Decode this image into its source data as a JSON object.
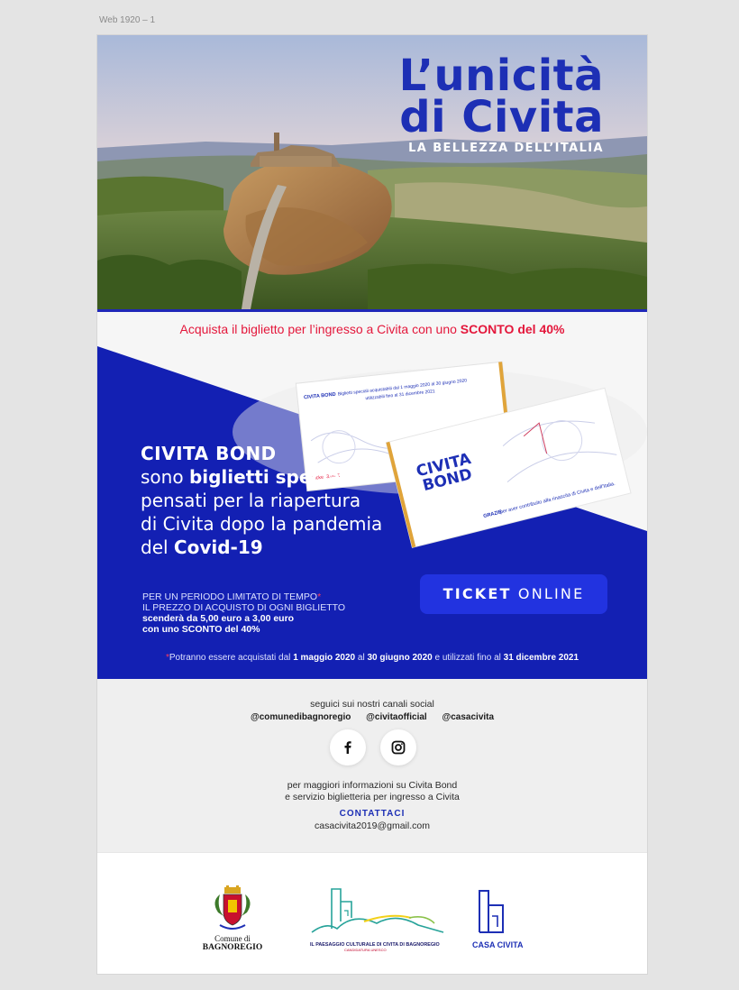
{
  "artboard": {
    "label": "Web 1920 – 1"
  },
  "hero": {
    "title_line1": "L’unicità",
    "title_line2": "di Civita",
    "subtitle": "LA BELLEZZA DELL’ITALIA"
  },
  "offer": {
    "text_prefix": "Acquista il biglietto per l’ingresso a Civita con uno ",
    "text_highlight": "SCONTO del 40%"
  },
  "tickets": {
    "back_brand": "CIVITA BOND",
    "back_text_line1": "Biglietti speciali acquistabili dal 1 maggio 2020 al 30 giugno 2020",
    "back_text_line2": "utilizzabili fino al 31 dicembre 2021",
    "back_price": "Ticket 3,00 €",
    "front_brand_line1": "CIVITA",
    "front_brand_line2": "BOND",
    "front_thanks_bold": "GRAZIE",
    "front_thanks_rest": " per aver contribuito alla rinascita di Civita e dell’Italia."
  },
  "bond": {
    "title": "CIVITA BOND",
    "line1_pre": "sono ",
    "line1_bold": "biglietti speciali",
    "line2": "pensati per la riapertura",
    "line3": "di Civita dopo la pandemia",
    "line4_pre": "del ",
    "line4_bold": "Covid-19"
  },
  "period": {
    "line1": "PER UN PERIODO LIMITATO DI TEMPO",
    "star": "*",
    "line2": "IL PREZZO DI ACQUISTO DI OGNI BIGLIETTO",
    "line3": "scenderà da 5,00 euro a 3,00 euro",
    "line4": "con uno SCONTO del 40%"
  },
  "cta": {
    "bold": "TICKET",
    "rest": " ONLINE"
  },
  "footnote": {
    "star": "*",
    "t1": "Potranno essere acquistati dal ",
    "d1": "1 maggio 2020",
    "t2": " al ",
    "d2": "30 giugno 2020",
    "t3": " e utilizzati fino al ",
    "d3": "31 dicembre 2021"
  },
  "social": {
    "follow_text": "seguici sui nostri canali social",
    "handles": [
      "@comunedibagnoregio",
      "@civitaofficial",
      "@casacivita"
    ],
    "info_line1": "per maggiori informazioni su Civita Bond",
    "info_line2": "e servizio biglietteria per ingresso a Civita",
    "contact_label": "CONTATTACI",
    "contact_email": "casacivita2019@gmail.com",
    "icons": [
      "facebook-icon",
      "instagram-icon"
    ]
  },
  "logos": {
    "comune_line1": "Comune di",
    "comune_line2": "BAGNOREGIO",
    "paesaggio_caption": "IL PAESAGGIO CULTURALE DI CIVITA DI BAGNOREGIO",
    "paesaggio_sub": "CANDIDATURA UNESCO",
    "casa_caption": "CASA CIVITA"
  },
  "colors": {
    "brand_blue": "#1d2fb5",
    "section_blue": "#1320b3",
    "button_blue": "#2233e0",
    "accent_red": "#e4173b"
  }
}
